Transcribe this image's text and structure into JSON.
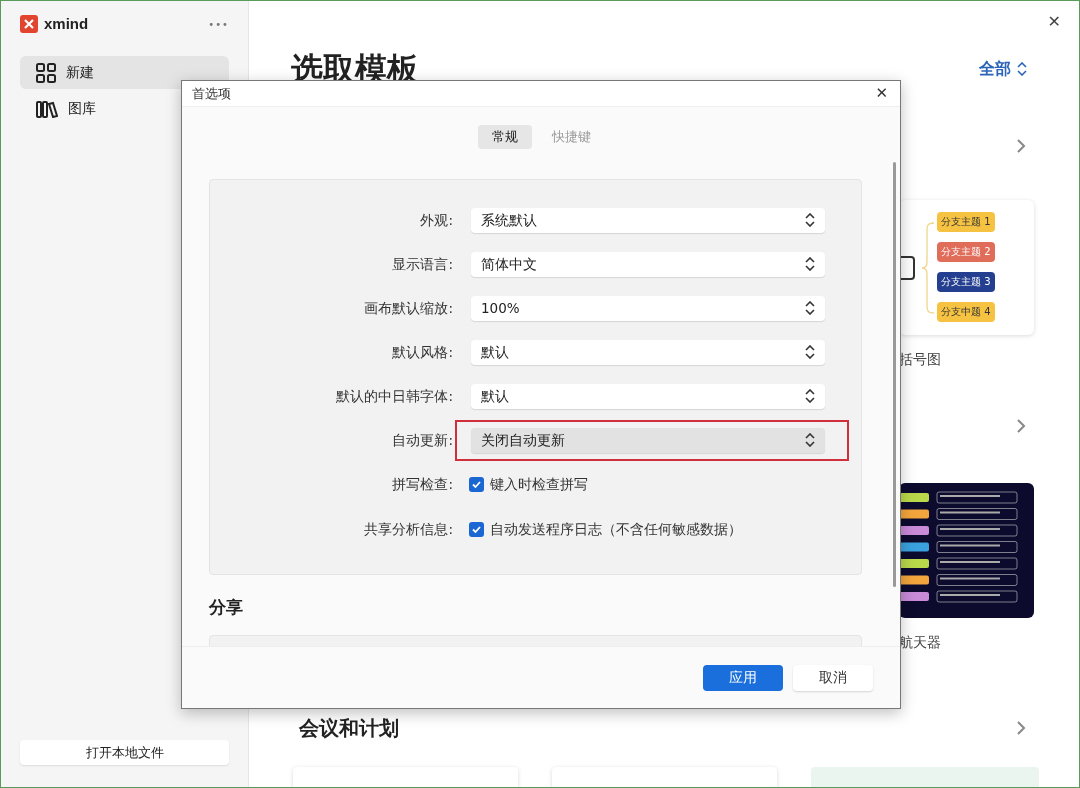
{
  "app": {
    "logo_text": "xmind",
    "more": "•••",
    "close": "✕"
  },
  "sidebar": {
    "items": [
      {
        "label": "新建",
        "selected": true
      },
      {
        "label": "图库",
        "selected": false
      }
    ],
    "open_button": "打开本地文件"
  },
  "main": {
    "title": "选取模板",
    "filter": "全部",
    "sections": [
      {
        "kind": "bracket_card",
        "label": "括号图",
        "branches": [
          {
            "text": "分支主题 1",
            "color": "#f5c242"
          },
          {
            "text": "分支主题 2",
            "color": "#e06c5a"
          },
          {
            "text": "分支主题 3",
            "color": "#243f8f"
          },
          {
            "text": "分支中题 4",
            "color": "#f5c242"
          }
        ]
      },
      {
        "kind": "dark_card",
        "label": "航天器"
      },
      {
        "kind": "heading",
        "title": "会议和计划"
      }
    ]
  },
  "dialog": {
    "title": "首选项",
    "tabs": [
      {
        "label": "常规",
        "selected": true
      },
      {
        "label": "快捷键",
        "selected": false
      }
    ],
    "settings": [
      {
        "kind": "select",
        "label": "外观:",
        "value": "系统默认",
        "highlighted": false
      },
      {
        "kind": "select",
        "label": "显示语言:",
        "value": "简体中文",
        "highlighted": false
      },
      {
        "kind": "select",
        "label": "画布默认缩放:",
        "value": "100%",
        "highlighted": false
      },
      {
        "kind": "select",
        "label": "默认风格:",
        "value": "默认",
        "highlighted": false
      },
      {
        "kind": "select",
        "label": "默认的中日韩字体:",
        "value": "默认",
        "highlighted": false
      },
      {
        "kind": "select",
        "label": "自动更新:",
        "value": "关闭自动更新",
        "highlighted": true
      },
      {
        "kind": "checkbox",
        "label": "拼写检查:",
        "value": "键入时检查拼写",
        "checked": true
      },
      {
        "kind": "checkbox",
        "label": "共享分析信息:",
        "value": "自动发送程序日志（不含任何敏感数据）",
        "checked": true
      }
    ],
    "share_heading": "分享",
    "buttons": [
      {
        "label": "应用",
        "kind": "primary"
      },
      {
        "label": "取消",
        "kind": "secondary"
      }
    ]
  }
}
